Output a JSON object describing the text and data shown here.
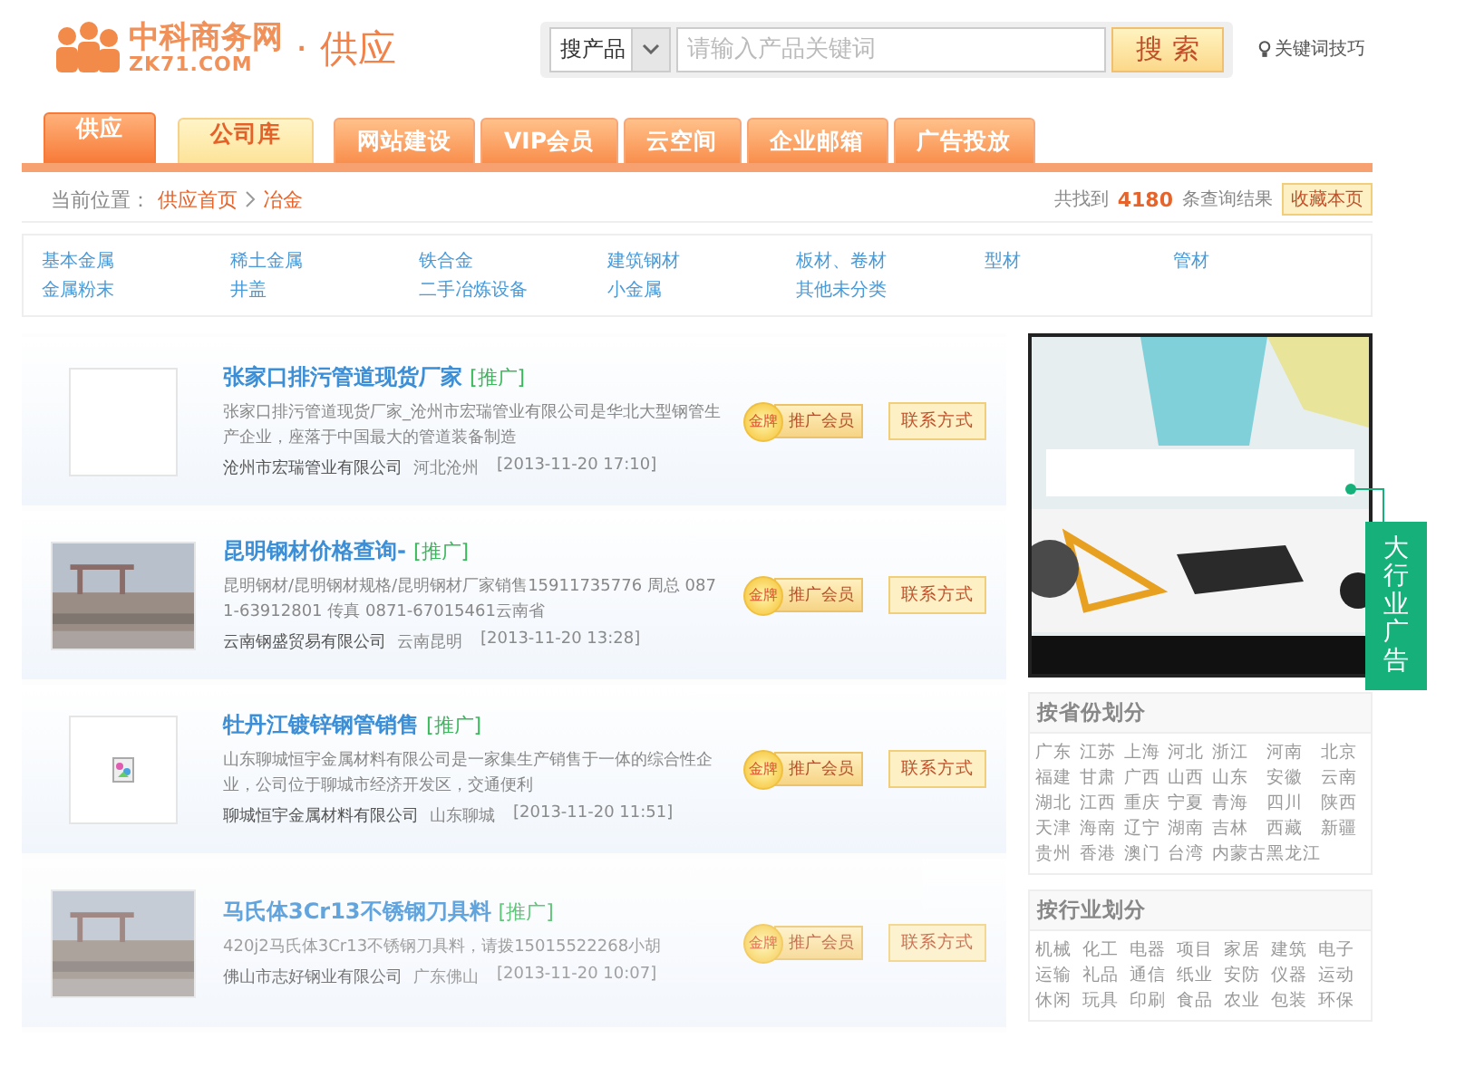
{
  "logo": {
    "name": "中科商务网",
    "domain": "ZK71.COM",
    "section": "· 供应"
  },
  "search": {
    "scope": "搜产品",
    "placeholder": "请输入产品关键词",
    "button": "搜 索",
    "tips": "关键词技巧"
  },
  "nav_tabs": [
    {
      "label": "供应",
      "kind": "main",
      "selected": true
    },
    {
      "label": "公司库",
      "kind": "main",
      "selected": false
    },
    {
      "label": "网站建设",
      "kind": "service",
      "selected": false
    },
    {
      "label": "VIP会员",
      "kind": "service",
      "selected": false
    },
    {
      "label": "云空间",
      "kind": "service",
      "selected": false
    },
    {
      "label": "企业邮箱",
      "kind": "service",
      "selected": false
    },
    {
      "label": "广告投放",
      "kind": "service",
      "selected": false
    }
  ],
  "breadcrumb": {
    "label": "当前位置：",
    "items": [
      "供应首页",
      "冶金"
    ]
  },
  "results": {
    "prefix": "共找到",
    "count": "4180",
    "suffix": "条查询结果",
    "bookmark": "收藏本页"
  },
  "categories": [
    "基本金属",
    "稀土金属",
    "铁合金",
    "建筑钢材",
    "板材、卷材",
    "型材",
    "管材",
    "金属粉末",
    "井盖",
    "二手冶炼设备",
    "小金属",
    "其他未分类"
  ],
  "listings": [
    {
      "kind": "blank",
      "title": "张家口排污管道现货厂家",
      "tag": "[推广]",
      "description": "张家口排污管道现货厂家_沧州市宏瑞管业有限公司是华北大型钢管生产企业，座落于中国最大的管道装备制造",
      "company": "沧州市宏瑞管业有限公司",
      "location": "河北沧州",
      "date": "[2013-11-20 17:10]",
      "medal": "金牌",
      "member": "推广会员",
      "contact": "联系方式",
      "faded": false
    },
    {
      "title": "昆明钢材价格查询-",
      "tag": "[推广]",
      "description": "昆明钢材/昆明钢材规格/昆明钢材厂家销售15911735776 周总 0871-63912801 传真 0871-67015461云南省",
      "company": "云南钢盛贸易有限公司",
      "location": "云南昆明",
      "date": "[2013-11-20 13:28]",
      "medal": "金牌",
      "member": "推广会员",
      "contact": "联系方式",
      "faded": false
    },
    {
      "kind": "broken-image",
      "title": "牡丹江镀锌钢管销售",
      "tag": "[推广]",
      "description": "山东聊城恒宇金属材料有限公司是一家集生产销售于一体的综合性企业，公司位于聊城市经济开发区，交通便利",
      "company": "聊城恒宇金属材料有限公司",
      "location": "山东聊城",
      "date": "[2013-11-20 11:51]",
      "medal": "金牌",
      "member": "推广会员",
      "contact": "联系方式",
      "faded": false
    },
    {
      "title": "马氏体3Cr13不锈钢刀具料",
      "tag": "[推广]",
      "description": "420j2马氏体3Cr13不锈钢刀具料，请拨15015522268小胡",
      "company": "佛山市志好钢业有限公司",
      "location": "广东佛山",
      "date": "[2013-11-20 10:07]",
      "medal": "金牌",
      "member": "推广会员",
      "contact": "联系方式",
      "faded": true
    }
  ],
  "ad_tab": "大行业广告",
  "province_filter": {
    "title": "按省份划分",
    "items": [
      "广东",
      "江苏",
      "上海",
      "河北",
      "浙江",
      "河南",
      "北京",
      "福建",
      "甘肃",
      "广西",
      "山西",
      "山东",
      "安徽",
      "云南",
      "湖北",
      "江西",
      "重庆",
      "宁夏",
      "青海",
      "四川",
      "陕西",
      "天津",
      "海南",
      "辽宁",
      "湖南",
      "吉林",
      "西藏",
      "新疆",
      "贵州",
      "香港",
      "澳门",
      "台湾",
      "内蒙古",
      "黑龙江"
    ]
  },
  "industry_filter": {
    "title": "按行业划分",
    "items": [
      "机械",
      "化工",
      "电器",
      "项目",
      "家居",
      "建筑",
      "电子",
      "运输",
      "礼品",
      "通信",
      "纸业",
      "安防",
      "仪器",
      "运动",
      "休闲",
      "玩具",
      "印刷",
      "食品",
      "农业",
      "包装",
      "环保"
    ]
  }
}
